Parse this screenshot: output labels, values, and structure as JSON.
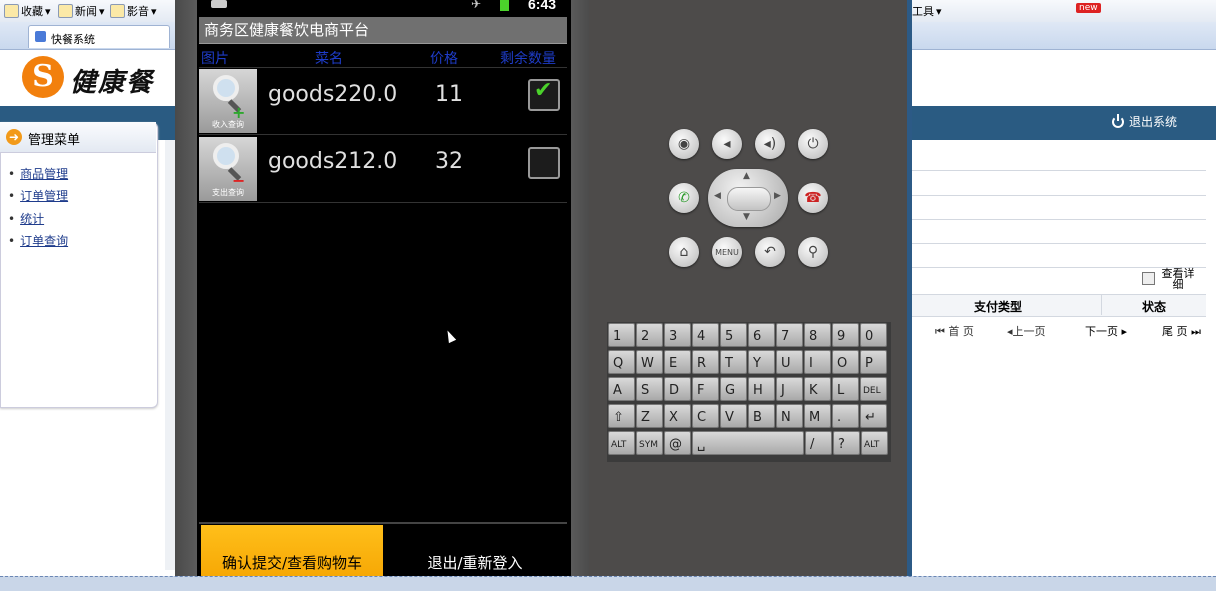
{
  "browser": {
    "toolbar_left": [
      "收藏",
      "新闻",
      "影音"
    ],
    "toolbar_right_tools": "工具",
    "toolbar_right_badge": "new",
    "tab_title": "快餐系统"
  },
  "web_page": {
    "logo_text": "健康餐",
    "logout_label": "退出系统",
    "menu_title": "管理菜单",
    "menu_items": [
      "商品管理",
      "订单管理",
      "统计",
      "订单查询"
    ],
    "detail_button": "查看详细",
    "table_headers": [
      "支付类型",
      "状态"
    ],
    "pager": [
      "首 页",
      "上一页",
      "下一页",
      "尾 页"
    ]
  },
  "phone": {
    "status_time": "6:43",
    "app_title": "商务区健康餐饮电商平台",
    "columns": [
      "图片",
      "菜名",
      "价格",
      "剩余数量"
    ],
    "rows": [
      {
        "thumb_caption": "收入查询",
        "name": "goods220.0",
        "price": "11",
        "checked": true
      },
      {
        "thumb_caption": "支出查询",
        "name": "goods212.0",
        "price": "32",
        "checked": false
      }
    ],
    "confirm_button": "确认提交/查看购物车",
    "exit_button": "退出/重新登入"
  },
  "emulator": {
    "menu_button": "MENU",
    "keyboard_rows": [
      [
        "1",
        "2",
        "3",
        "4",
        "5",
        "6",
        "7",
        "8",
        "9",
        "0"
      ],
      [
        "Q",
        "W",
        "E",
        "R",
        "T",
        "Y",
        "U",
        "I",
        "O",
        "P"
      ],
      [
        "A",
        "S",
        "D",
        "F",
        "G",
        "H",
        "J",
        "K",
        "L",
        "DEL"
      ],
      [
        "⇧",
        "Z",
        "X",
        "C",
        "V",
        "B",
        "N",
        "M",
        ".",
        "↵"
      ],
      [
        "ALT",
        "SYM",
        "@",
        "␣",
        "/",
        "?",
        "ALT"
      ]
    ]
  },
  "icons": [
    "favorites-icon",
    "power-icon",
    "arrow-icon",
    "magnifier-icon",
    "checkmark-icon",
    "camera-icon",
    "volume-down-icon",
    "volume-up-icon",
    "power-button-icon",
    "call-icon",
    "end-call-icon",
    "home-icon",
    "back-icon",
    "search-icon"
  ]
}
